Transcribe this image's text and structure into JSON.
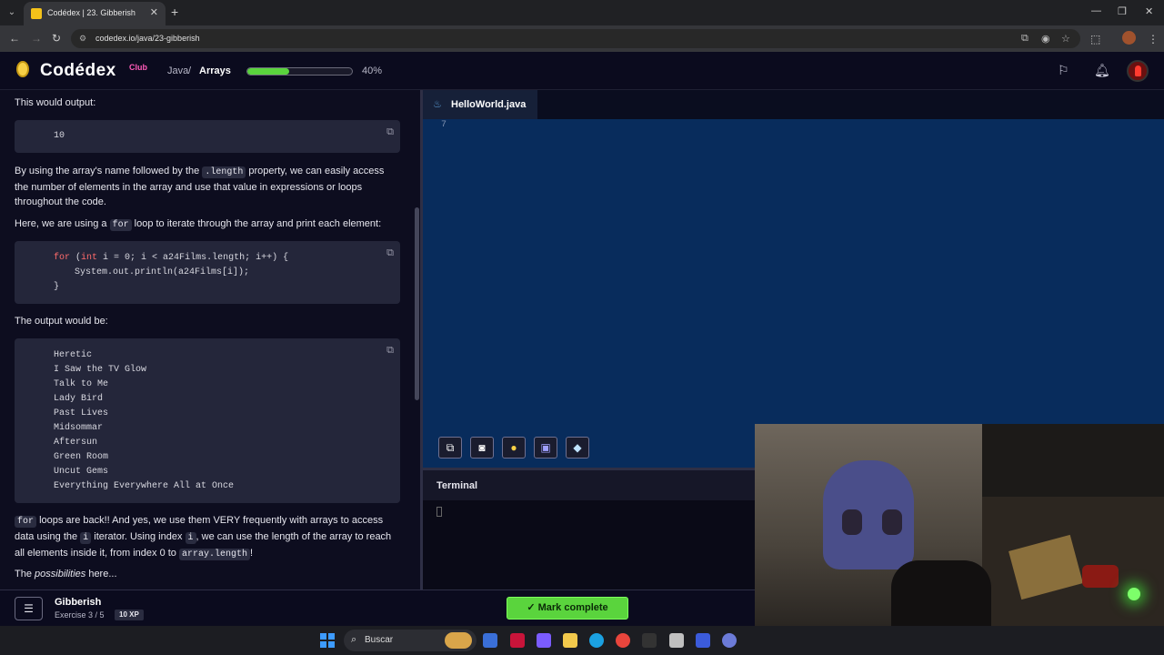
{
  "browser": {
    "tab_title": "Codédex | 23. Gibberish",
    "url": "codedex.io/java/23-gibberish",
    "new_tab": "+",
    "tab_close": "✕"
  },
  "header": {
    "logo_text": "Codédex",
    "logo_badge": "Club",
    "course": "Java",
    "separator": "/",
    "chapter": "Arrays",
    "progress": 0.4,
    "progress_label": "40%"
  },
  "lesson": {
    "p_output": "This would output:",
    "code1": "10",
    "p_length_1": "By using the array's name followed by the ",
    "p_length_code": ".length",
    "p_length_2": " property, we can easily access the number of elements in the array and use that value in expressions or loops throughout the code.",
    "p_loop_1": "Here, we are using a ",
    "p_loop_code": "for",
    "p_loop_2": " loop to iterate through the array and print each element:",
    "code2": {
      "line1_kw": "for",
      "line1_rest_open": " (",
      "line1_int": "int",
      "line1_rest": " i = 0; i < a24Films.length; i++) {",
      "line2": "System.out.println(a24Films[i]);",
      "line3": "}"
    },
    "p_output2": "The output would be:",
    "films": [
      "Heretic",
      "I Saw the TV Glow",
      "Talk to Me",
      "Lady Bird",
      "Past Lives",
      "Midsommar",
      "Aftersun",
      "Green Room",
      "Uncut Gems",
      "Everything Everywhere All at Once"
    ],
    "p_back_code": "for",
    "p_back_1": " loops are back!! And yes, we use them VERY frequently with arrays to access data using the ",
    "p_back_i": "i",
    "p_back_2": " iterator. Using index ",
    "p_back_i2": "i",
    "p_back_3": ", we can use the length of the array to reach all elements inside it, from index 0 to ",
    "p_back_code2": "array.length",
    "p_back_4": "!",
    "p_possible_1": "The ",
    "p_possible_em": "possibilities",
    "p_possible_2": " here..."
  },
  "editor": {
    "file_name": "HelloWorld.java",
    "line_number": "7"
  },
  "terminal": {
    "title": "Terminal"
  },
  "bottom": {
    "exercise_name": "Gibberish",
    "exercise_count": "Exercise 3 / 5",
    "xp": "10 XP",
    "mark_complete": "Mark complete"
  },
  "taskbar": {
    "search_label": "Buscar"
  },
  "icons": {
    "copy": "copy-icon",
    "flag": "flag-icon",
    "bell": "bell-icon",
    "java": "java-icon"
  },
  "colors": {
    "accent_green": "#5ad43d",
    "editor_bg": "#082c5c",
    "keyword": "#ff6b6b"
  }
}
